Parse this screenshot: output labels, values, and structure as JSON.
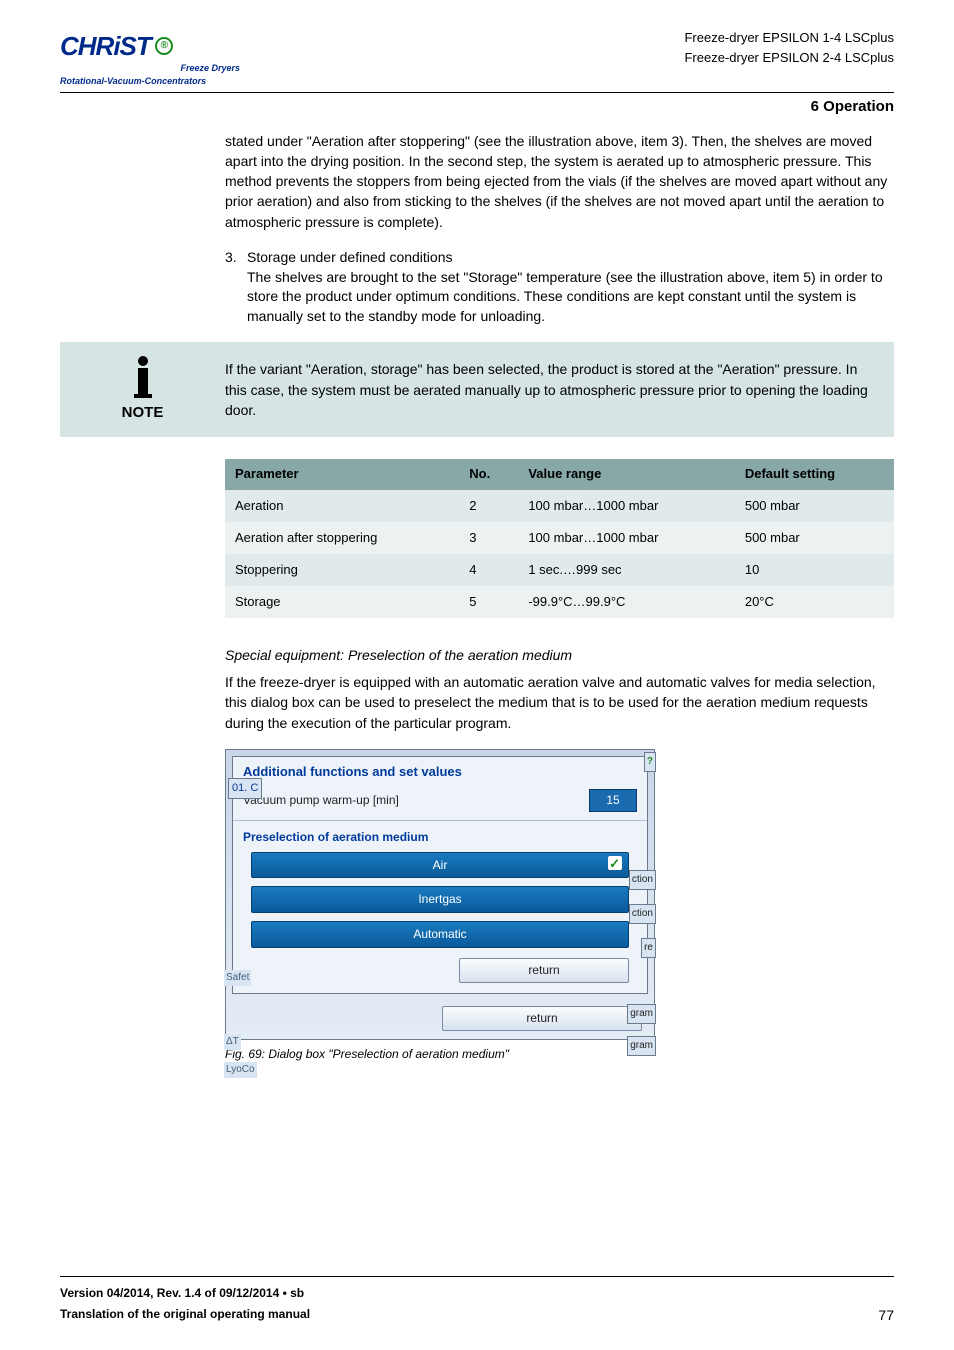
{
  "header": {
    "logo_brand": "CHRiST",
    "logo_reg": "®",
    "logo_sub1": "Freeze Dryers",
    "logo_sub2": "Rotational-Vacuum-Concentrators",
    "product1": "Freeze-dryer EPSILON 1-4 LSCplus",
    "product2": "Freeze-dryer EPSILON 2-4 LSCplus",
    "section": "6 Operation"
  },
  "para1": "stated under \"Aeration after stoppering\" (see the illustration above, item 3). Then, the shelves are moved apart into the drying position. In the second step, the system is aerated up to atmospheric pressure. This method prevents the stoppers from being ejected from the vials (if the shelves are moved apart without any prior aeration) and also from sticking to the shelves (if the shelves are not moved apart until the aeration to atmospheric pressure is complete).",
  "list3": {
    "num": "3.",
    "title": "Storage under defined conditions",
    "body": "The shelves are brought to the set \"Storage\" temperature (see the illustration above, item 5) in order to store the product under optimum conditions. These conditions are kept constant until the system is manually set to the standby mode for unloading."
  },
  "note": {
    "label": "NOTE",
    "text": "If the variant \"Aeration, storage\" has been selected, the product is stored at the \"Aeration\" pressure. In this case, the system must be aerated manually up to atmospheric pressure prior to opening the loading door."
  },
  "table": {
    "headers": [
      "Parameter",
      "No.",
      "Value range",
      "Default setting"
    ],
    "rows": [
      [
        "Aeration",
        "2",
        "100 mbar…1000 mbar",
        "500 mbar"
      ],
      [
        "Aeration after stoppering",
        "3",
        "100 mbar…1000 mbar",
        "500 mbar"
      ],
      [
        "Stoppering",
        "4",
        "1 sec.…999 sec",
        "10"
      ],
      [
        "Storage",
        "5",
        "-99.9°C…99.9°C",
        "20°C"
      ]
    ]
  },
  "special": {
    "heading": "Special equipment: Preselection of the aeration medium",
    "body": "If the freeze-dryer is equipped with an automatic aeration valve and automatic valves for media selection, this dialog box can be used to preselect the medium that is to be used for the aeration medium requests during the execution of the particular program."
  },
  "dialog": {
    "badge": "01. C",
    "title": "Additional functions and set values",
    "pump_label": "Vacuum pump warm-up [min]",
    "pump_value": "15",
    "sub": "Preselection of aeration medium",
    "btn_air": "Air",
    "btn_inert": "Inertgas",
    "btn_auto": "Automatic",
    "return": "return",
    "q": "?",
    "ction": "ction",
    "re": "re",
    "gram": "gram",
    "safet": "Safet",
    "dt": "ΔT",
    "lyo": "LyoCo"
  },
  "fig_caption": "Fig. 69: Dialog box \"Preselection of aeration medium\"",
  "footer": {
    "line1": "Version 04/2014, Rev. 1.4 of 09/12/2014 • sb",
    "line2": "Translation of the original operating manual",
    "page": "77"
  }
}
